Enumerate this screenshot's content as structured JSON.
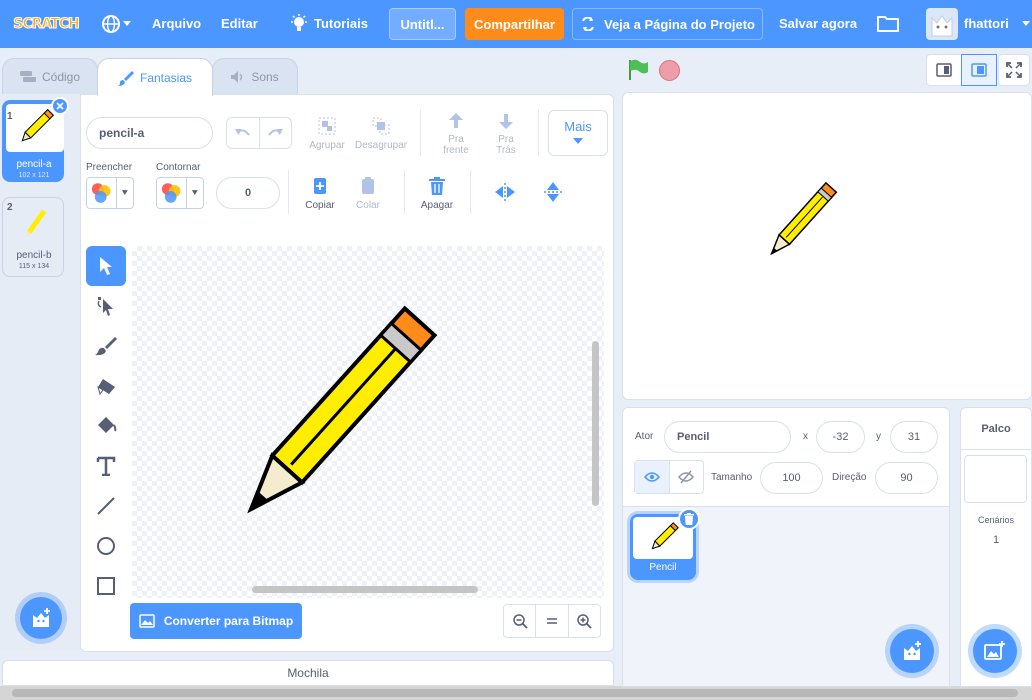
{
  "menubar": {
    "logo": "SCRATCH",
    "file": "Arquivo",
    "edit": "Editar",
    "tutorials": "Tutoriais",
    "project_title": "Untitl...",
    "share": "Compartilhar",
    "see_project": "Veja a Página do Projeto",
    "save_now": "Salvar agora",
    "username": "fhattori"
  },
  "tabs": {
    "code": "Código",
    "costumes": "Fantasias",
    "sounds": "Sons"
  },
  "costumes": [
    {
      "number": "1",
      "name": "pencil-a",
      "size": "102 x 121"
    },
    {
      "number": "2",
      "name": "pencil-b",
      "size": "115 x 134"
    }
  ],
  "editor": {
    "costume_name": "pencil-a",
    "group": "Agrupar",
    "ungroup": "Desagrupar",
    "forward": "Pra\nfrente",
    "backward": "Pra\nTrás",
    "more": "Mais",
    "fill_label": "Preencher",
    "outline_label": "Contornar",
    "outline_width": "0",
    "copy": "Copiar",
    "paste": "Colar",
    "delete": "Apagar",
    "convert_bitmap": "Converter para Bitmap"
  },
  "backpack": "Mochila",
  "sprite_info": {
    "sprite_label": "Ator",
    "sprite_name": "Pencil",
    "x_label": "x",
    "x_value": "-32",
    "y_label": "y",
    "y_value": "31",
    "size_label": "Tamanho",
    "size_value": "100",
    "direction_label": "Direção",
    "direction_value": "90"
  },
  "sprites": [
    {
      "name": "Pencil"
    }
  ],
  "stage_panel": {
    "title": "Palco",
    "backdrops_label": "Cenários",
    "backdrops_count": "1"
  },
  "colors": {
    "menubar": "#4c97ff",
    "share": "#ff8c1a",
    "accent": "#855cd6",
    "pencil_yellow": "#ffee00",
    "eraser_orange": "#ff8c1a"
  }
}
